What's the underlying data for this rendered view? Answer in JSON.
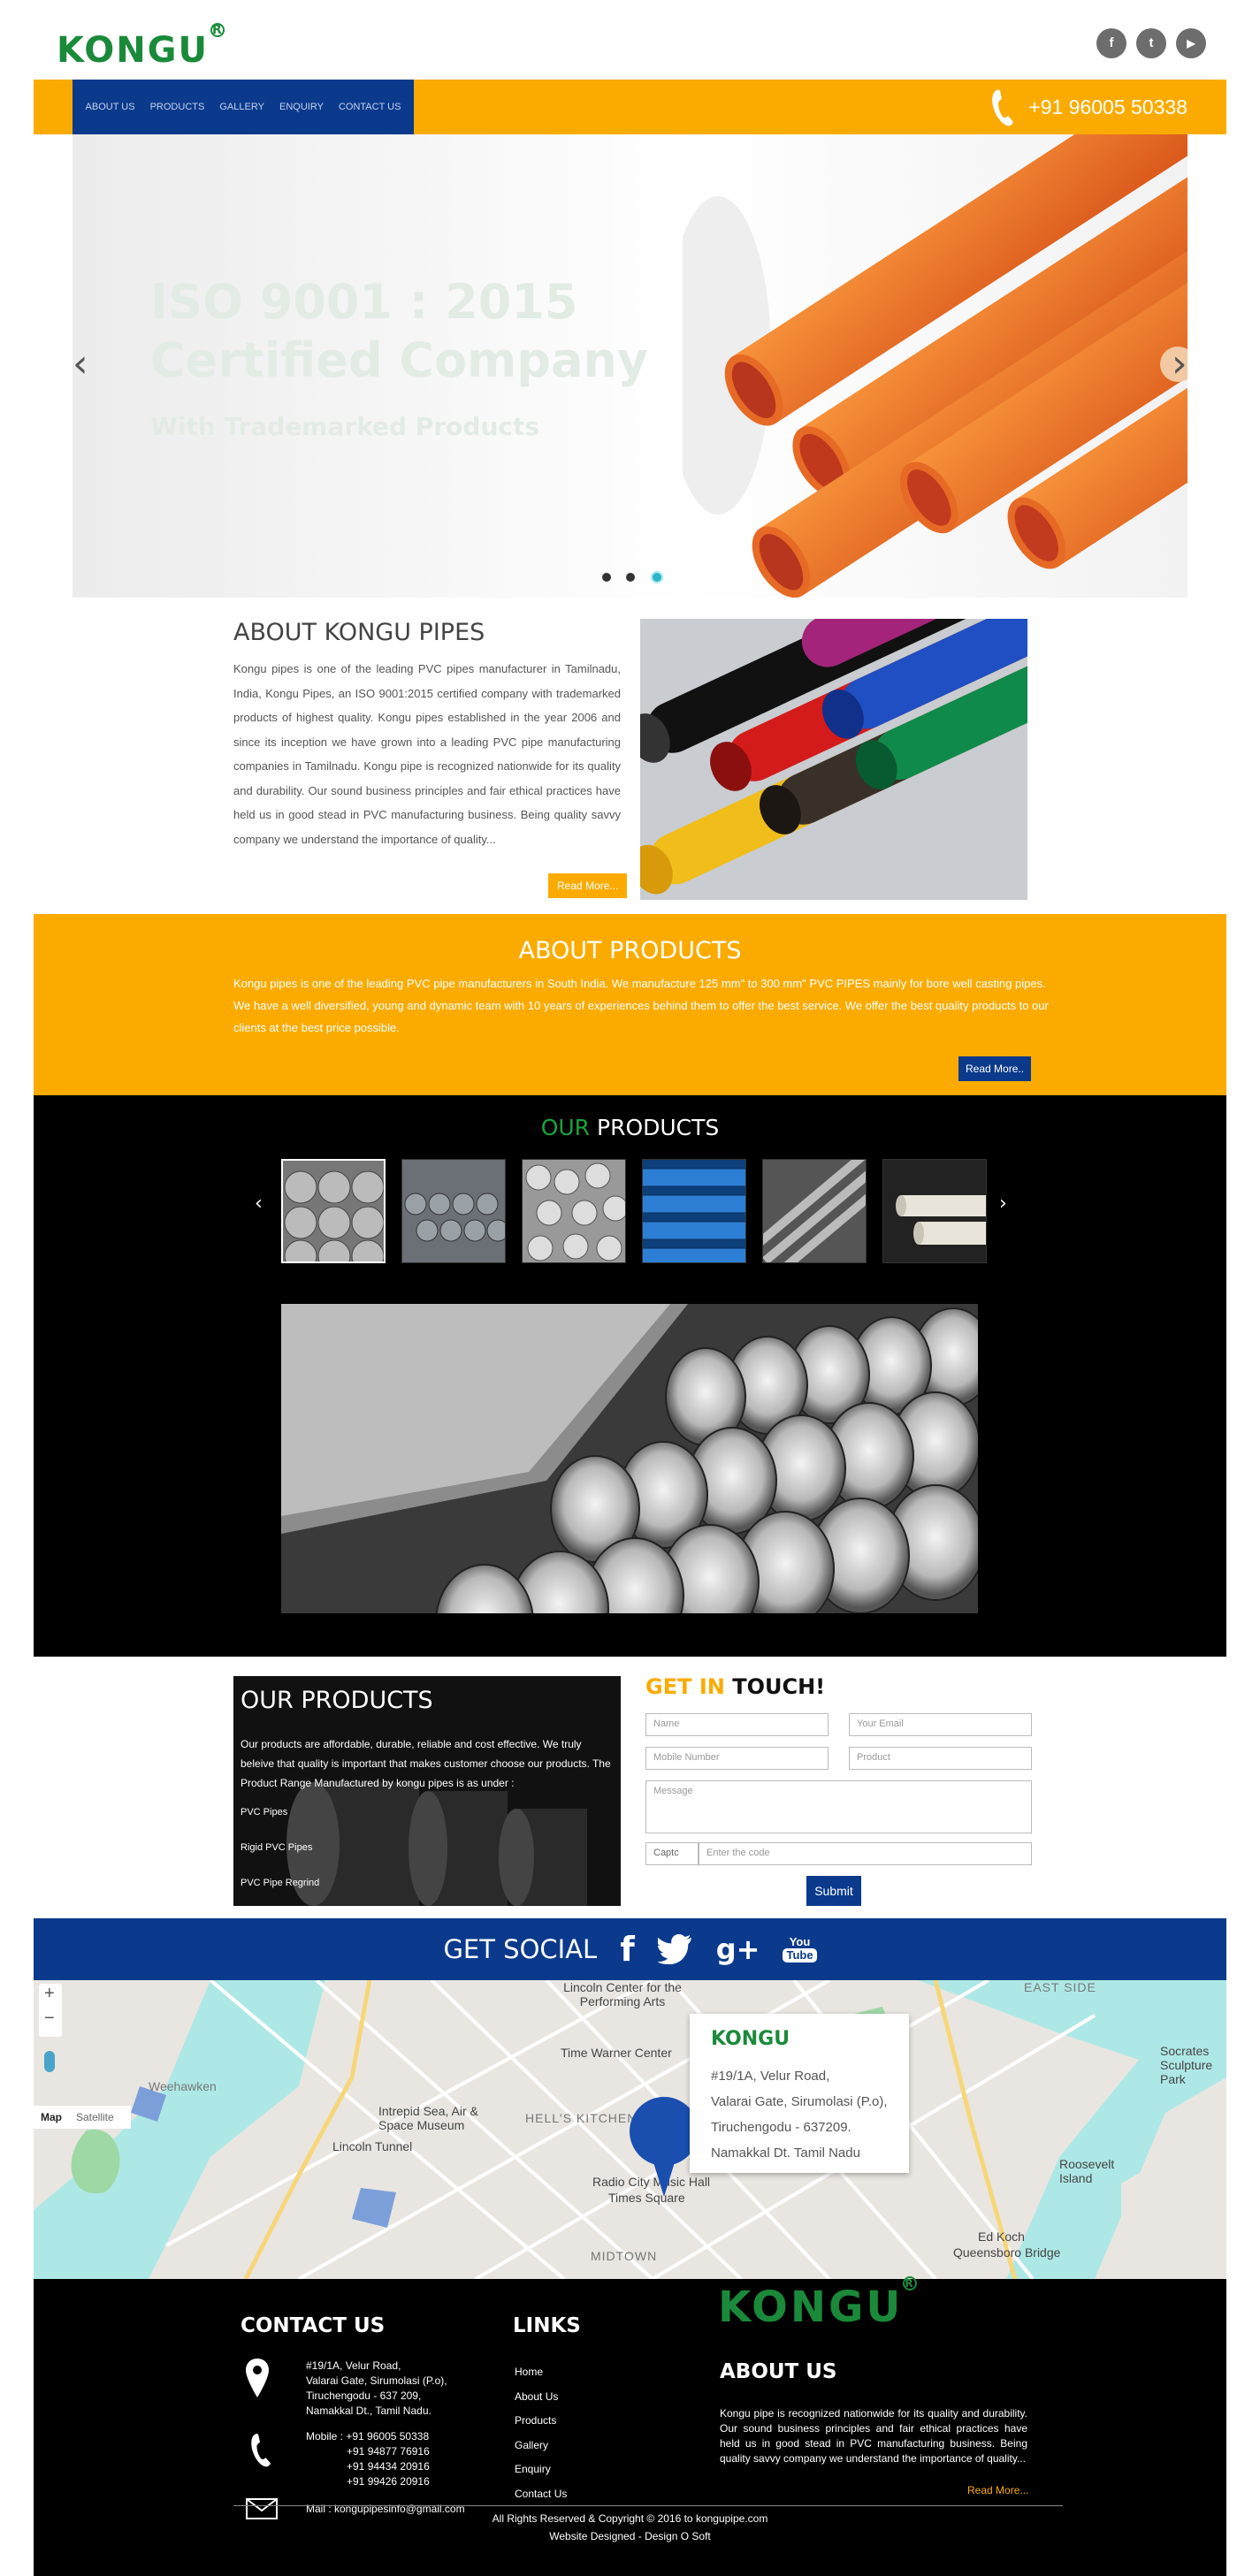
{
  "header": {
    "logo": "KONGU",
    "logo_mark": "R",
    "social_icons": [
      "facebook-icon",
      "twitter-icon",
      "youtube-icon"
    ],
    "social_glyphs": [
      "f",
      "t",
      "▶"
    ]
  },
  "nav": {
    "items": [
      "ABOUT US",
      "PRODUCTS",
      "GALLERY",
      "ENQUIRY",
      "CONTACT US"
    ],
    "phone": "+91 96005 50338"
  },
  "slider": {
    "line1": "ISO 9001 : 2015",
    "line2": "Certified Company",
    "line3": "With Trademarked Products",
    "prev": "‹",
    "next": "›",
    "active_index": 2,
    "dots": 3
  },
  "about": {
    "title": "ABOUT KONGU PIPES",
    "text": "Kongu pipes is one of the leading PVC pipes manufacturer in Tamilnadu, India, Kongu Pipes, an ISO 9001:2015 certified company with trademarked products of highest quality. Kongu pipes established in the year 2006 and since its inception we have grown into a leading PVC pipe manufacturing companies in Tamilnadu. Kongu pipe is recognized nationwide for its quality and durability. Our sound business principles and fair ethical practices have held us in good stead in PVC manufacturing business. Being quality savvy company we understand the importance of quality...",
    "read_more": "Read More..."
  },
  "about_products": {
    "title": "ABOUT PRODUCTS",
    "text": "Kongu pipes is one of the leading PVC pipe manufacturers in South India. We manufacture 125 mm\" to 300 mm\" PVC PIPES mainly for bore well casting pipes. We have a well diversified, young and dynamic team with 10 years of experiences behind them to offer the best service. We offer the best quality products to our clients at the best price possible.",
    "read_more": "Read More.."
  },
  "our_products": {
    "title_accent": "OUR",
    "title_rest": " PRODUCTS",
    "prev": "‹",
    "next": "›"
  },
  "products_box": {
    "title": "OUR PRODUCTS",
    "text": "Our products are affordable, durable, reliable and cost effective. We truly beleive that quality is important that makes customer choose our products. The Product Range Manufactured by kongu pipes is as under :",
    "items": [
      "PVC Pipes",
      "Rigid PVC Pipes",
      "PVC Pipe Regrind"
    ]
  },
  "contact_form": {
    "title_accent": "GET IN",
    "title_rest": " TOUCH!",
    "name_ph": "Name",
    "email_ph": "Your Email",
    "mobile_ph": "Mobile Number",
    "product_ph": "Product",
    "message_ph": "Message",
    "captcha_alt": "Captc",
    "code_ph": "Enter the code",
    "submit": "Submit"
  },
  "social_bar": {
    "title": "GET SOCIAL",
    "icons": [
      "facebook-icon",
      "twitter-icon",
      "google-plus-icon",
      "youtube-icon"
    ],
    "fb": "f",
    "gp": "g+",
    "yt_you": "You",
    "yt_tube": "Tube"
  },
  "map": {
    "zoom_in": "+",
    "zoom_out": "−",
    "type_map": "Map",
    "type_satellite": "Satellite",
    "card_logo": "KONGU",
    "card_lines": [
      "#19/1A, Velur Road,",
      "Valarai Gate, Sirumolasi (P.o),",
      "Tiruchengodu - 637209.",
      "Namakkal Dt. Tamil Nadu"
    ],
    "labels": [
      "Lincoln Center for the Performing Arts",
      "Time Warner Center",
      "Intrepid Sea, Air & Space Museum",
      "HELL'S KITCHEN",
      "Radio City Music Hall",
      "Times Square",
      "MIDTOWN",
      "Lincoln Tunnel",
      "Weehawken",
      "EAST SIDE",
      "Socrates Sculpture Park",
      "Roosevelt Island",
      "Queensboro Bridge",
      "Ed Koch"
    ]
  },
  "footer": {
    "contact_title": "CONTACT US",
    "address": [
      "#19/1A, Velur Road,",
      "Valarai Gate, Sirumolasi (P.o),",
      "Tiruchengodu - 637 209,",
      "Namakkal Dt., Tamil Nadu."
    ],
    "mobile_label": "Mobile : +91 96005 50338",
    "mobiles": [
      "+91 94877 76916",
      "+91 94434 20916",
      "+91 99426 20916"
    ],
    "mail": "Mail : kongupipesinfo@gmail.com",
    "links_title": "LINKS",
    "links": [
      "Home",
      "About Us",
      "Products",
      "Gallery",
      "Enquiry",
      "Contact Us"
    ],
    "logo": "KONGU",
    "about_title": "ABOUT US",
    "about_text": "Kongu pipe is recognized nationwide for its quality and durability. Our sound business principles and fair ethical practices have held us in good stead in PVC manufacturing business. Being quality savvy company we understand the importance of quality...",
    "read_more": "Read More...",
    "copyright": "All Rights Reserved & Copyright © 2016 to kongupipe.com",
    "designed": "Website Designed - Design O Soft"
  },
  "colors": {
    "brand_green": "#1a8a3a",
    "accent_yellow": "#fbab00",
    "navy": "#0b3a8c"
  }
}
